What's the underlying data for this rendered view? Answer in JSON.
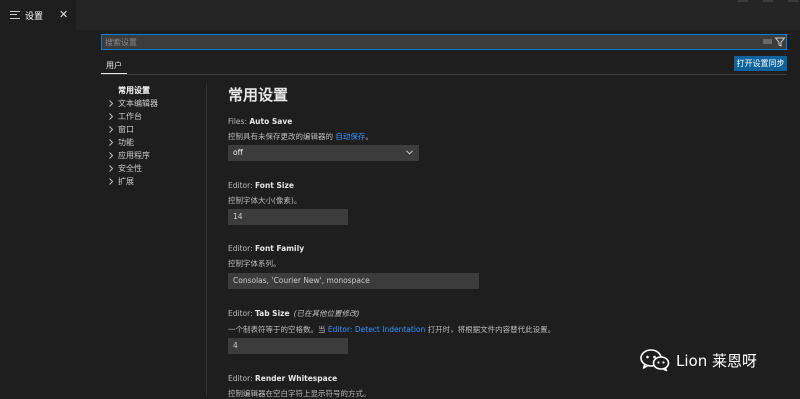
{
  "tab": {
    "title": "设置"
  },
  "search": {
    "placeholder": "搜索设置"
  },
  "scope_tab": "用户",
  "sync_button": "打开设置同步",
  "toc": [
    {
      "label": "常用设置",
      "expandable": false,
      "active": true
    },
    {
      "label": "文本编辑器",
      "expandable": true
    },
    {
      "label": "工作台",
      "expandable": true
    },
    {
      "label": "窗口",
      "expandable": true
    },
    {
      "label": "功能",
      "expandable": true
    },
    {
      "label": "应用程序",
      "expandable": true
    },
    {
      "label": "安全性",
      "expandable": true
    },
    {
      "label": "扩展",
      "expandable": true
    }
  ],
  "section_title": "常用设置",
  "settings": {
    "auto_save": {
      "category": "Files: ",
      "name": "Auto Save",
      "desc_before": "控制具有未保存更改的编辑器的 ",
      "desc_link": "自动保存",
      "desc_after": "。",
      "value": "off"
    },
    "font_size": {
      "category": "Editor: ",
      "name": "Font Size",
      "desc": "控制字体大小(像素)。",
      "value": "14"
    },
    "font_family": {
      "category": "Editor: ",
      "name": "Font Family",
      "desc": "控制字体系列。",
      "value": "Consolas, 'Courier New', monospace"
    },
    "tab_size": {
      "category": "Editor: ",
      "name": "Tab Size",
      "note": "(已在其他位置修改)",
      "desc_before": "一个制表符等于的空格数。当 ",
      "desc_link": "Editor: Detect Indentation",
      "desc_after": " 打开时，将根据文件内容替代此设置。",
      "value": "4"
    },
    "render_whitespace": {
      "category": "Editor: ",
      "name": "Render Whitespace",
      "desc": "控制编辑器在空白字符上显示符号的方式。"
    }
  },
  "watermark": {
    "text": "Lion 莱恩呀",
    "icon": "wechat-icon"
  },
  "colors": {
    "accent": "#007fd4",
    "button": "#0e639c",
    "link": "#3794ff",
    "background": "#1e1e1e"
  }
}
